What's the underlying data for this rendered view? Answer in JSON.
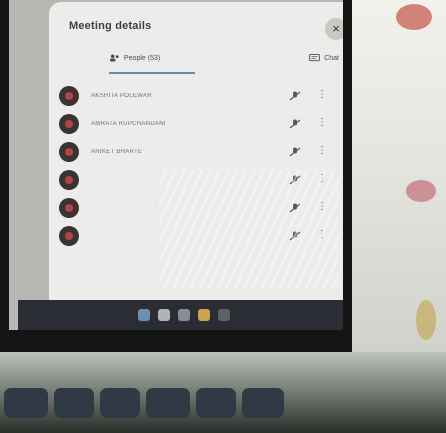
{
  "panel": {
    "title": "Meeting details",
    "close_glyph": "×"
  },
  "tabs": {
    "people_label": "People (53)",
    "chat_label": "Chat"
  },
  "participants": [
    {
      "name": "AKSHITA POLEWAR"
    },
    {
      "name": "AMRATA RUPCHANDANI"
    },
    {
      "name": "ANIKET BHARTE"
    },
    {
      "name": ""
    },
    {
      "name": ""
    },
    {
      "name": ""
    }
  ],
  "icons": {
    "people": "people-icon",
    "chat": "chat-icon",
    "mic_off": "mic-off-icon",
    "more": "more-vert-icon"
  },
  "colors": {
    "panel_bg": "#ecedea",
    "accent": "#6b8aa8",
    "avatar_dot": "#b04648",
    "taskbar": "#2a2d33"
  }
}
